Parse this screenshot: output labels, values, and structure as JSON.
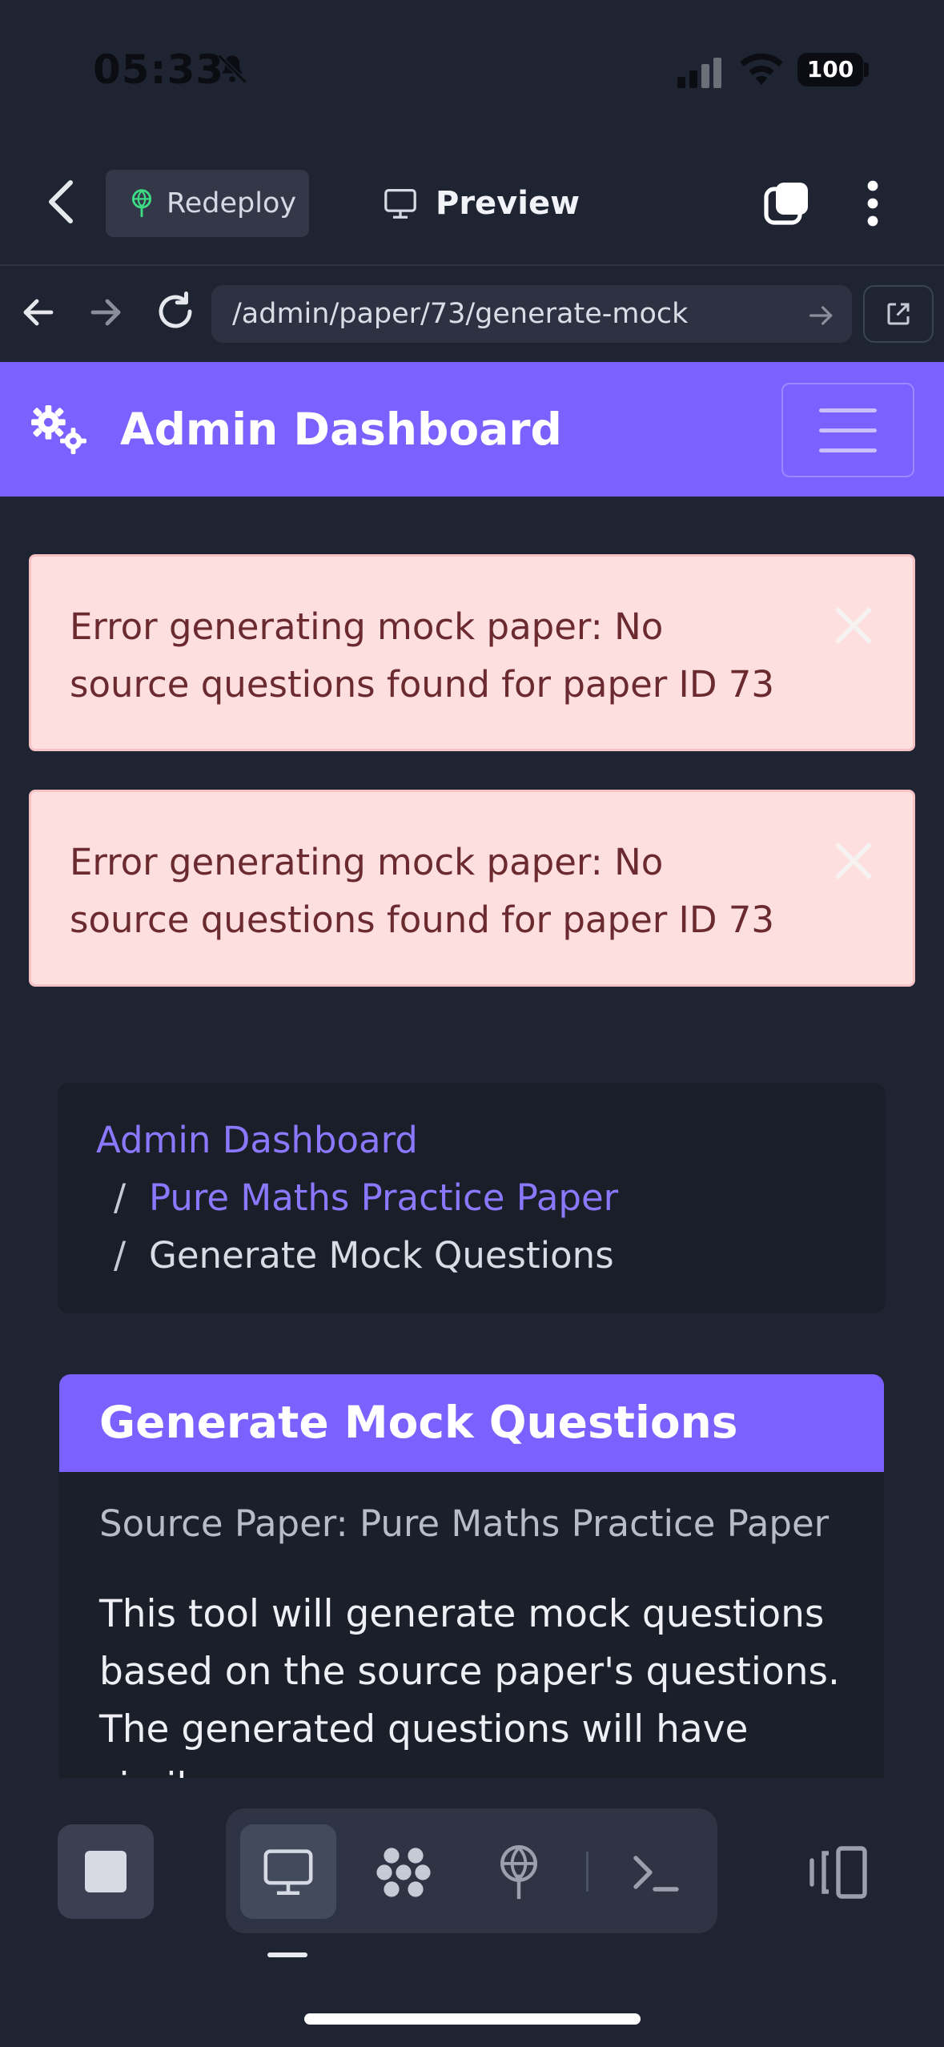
{
  "status_bar": {
    "time": "05:33",
    "battery": "100"
  },
  "toolbar": {
    "redeploy_label": "Redeploy",
    "preview_label": "Preview"
  },
  "browser": {
    "url": "/admin/paper/73/generate-mock"
  },
  "navbar": {
    "brand": "Admin Dashboard"
  },
  "alerts": [
    {
      "message": "Error generating mock paper: No source questions found for paper ID 73"
    },
    {
      "message": "Error generating mock paper: No source questions found for paper ID 73"
    }
  ],
  "breadcrumb": {
    "items": [
      {
        "label": "Admin Dashboard"
      },
      {
        "label": "Pure Maths Practice Paper"
      },
      {
        "label": "Generate Mock Questions"
      }
    ],
    "separator": "/"
  },
  "card": {
    "title": "Generate Mock Questions",
    "source_paper": "Source Paper: Pure Maths Practice Paper",
    "description": "This tool will generate mock questions based on the source paper's questions. The generated questions will have similar"
  },
  "colors": {
    "accent": "#7b61ff",
    "alert_bg": "#fddfe0",
    "alert_text": "#6b2a30",
    "background": "#1f2433"
  }
}
